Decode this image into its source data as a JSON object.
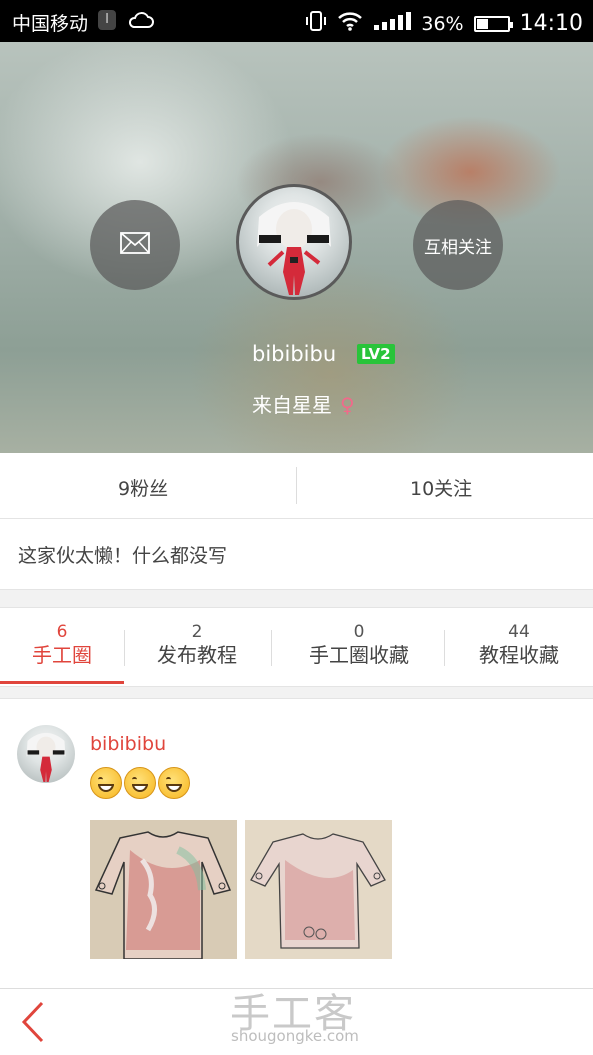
{
  "status_bar": {
    "carrier": "中国移动",
    "sim_indicator": "I",
    "battery": "36%",
    "battery_level": 0.36,
    "time": "14:10"
  },
  "profile": {
    "follow_button": "互相关注",
    "username": "bibibibu",
    "level": "LV2",
    "origin": "来自星星",
    "gender_symbol": "♀"
  },
  "stats": {
    "fans": "9粉丝",
    "following": "10关注"
  },
  "bio": "这家伙太懒！什么都没写",
  "tabs": [
    {
      "count": "6",
      "label": "手工圈"
    },
    {
      "count": "2",
      "label": "发布教程"
    },
    {
      "count": "0",
      "label": "手工圈收藏"
    },
    {
      "count": "44",
      "label": "教程收藏"
    }
  ],
  "post": {
    "username": "bibibibu"
  },
  "watermark": {
    "title": "手工客",
    "url": "shougongke.com"
  },
  "colors": {
    "accent": "#e0453c",
    "level_badge": "#29c43a"
  }
}
